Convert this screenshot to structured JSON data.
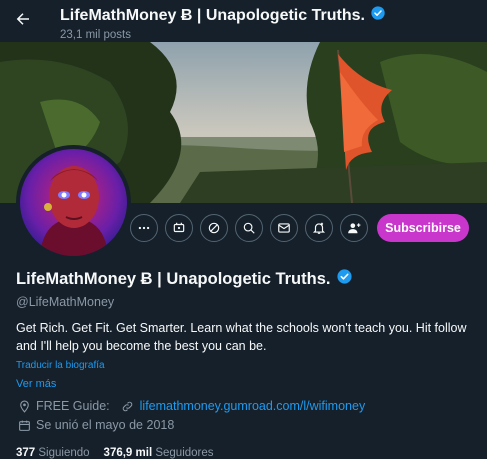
{
  "header": {
    "title": "LifeMathMoney Ƀ | Unapologetic Truths.",
    "posts_count": "23,1 mil posts"
  },
  "profile": {
    "name": "LifeMathMoney Ƀ | Unapologetic Truths.",
    "handle": "@LifeMathMoney",
    "bio_line1": "Get Rich. Get Fit. Get Smarter. Learn what the schools won't teach you. Hit follow",
    "bio_line2": "and I'll help you become the best you can be.",
    "translate_label": "Traducir la biografía",
    "see_more_label": "Ver más",
    "location_label": "FREE Guide:",
    "website": "lifemathmoney.gumroad.com/l/wifimoney",
    "joined": "Se unió el mayo de 2018",
    "following_count": "377",
    "following_label": "Siguiendo",
    "followers_count": "376,9 mil",
    "followers_label": "Seguidores"
  },
  "actions": {
    "subscribe_label": "Subscribirse",
    "icons": [
      "more-icon",
      "grok-icon",
      "circle-slash-icon",
      "search-icon",
      "message-icon",
      "notification-icon",
      "follow-icon"
    ]
  },
  "colors": {
    "background": "#15202b",
    "accent": "#1d9bf0",
    "subscribe": "#c936cc",
    "muted": "#8b98a5",
    "verified": "#1d9bf0"
  }
}
